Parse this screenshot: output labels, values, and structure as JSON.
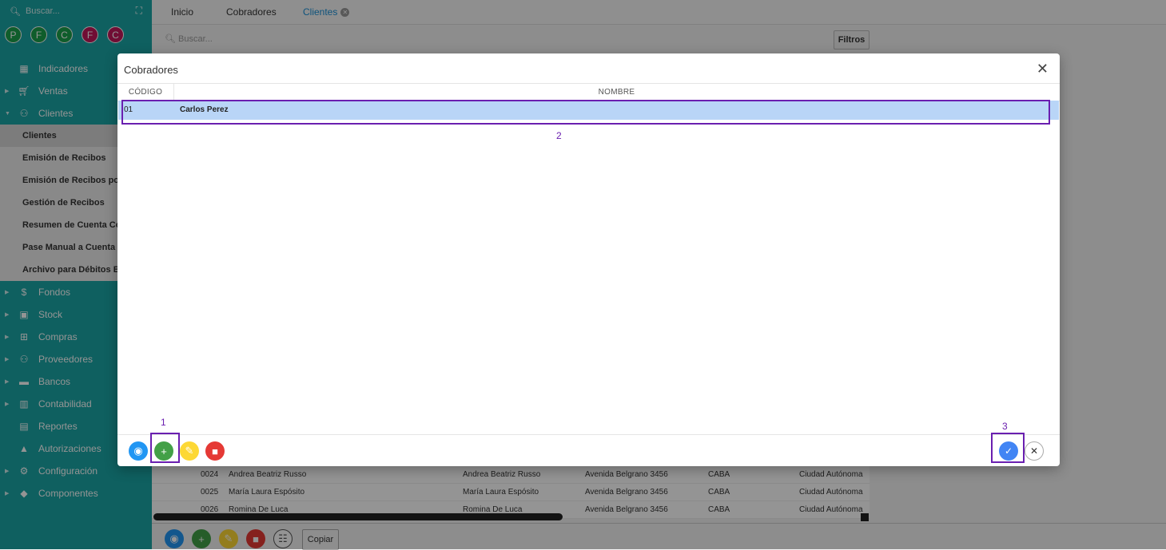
{
  "sidebar": {
    "search_placeholder": "Buscar...",
    "avatars": [
      {
        "letter": "P",
        "color": "#1aa04a"
      },
      {
        "letter": "F",
        "color": "#1aa04a"
      },
      {
        "letter": "C",
        "color": "#1aa04a"
      },
      {
        "letter": "F",
        "color": "#c2185b"
      },
      {
        "letter": "C",
        "color": "#c2185b"
      }
    ],
    "menu_top": [
      {
        "label": "Indicadores",
        "icon": "dashboard-icon"
      },
      {
        "label": "Ventas",
        "icon": "cart-icon"
      },
      {
        "label": "Clientes",
        "icon": "users-icon"
      }
    ],
    "clientes_sub": [
      "Clientes",
      "Emisión de Recibos",
      "Emisión de Recibos por l",
      "Gestión de Recibos",
      "Resumen de Cuenta Corr",
      "Pase Manual a Cuenta C",
      "Archivo para Débitos Bar"
    ],
    "menu_bottom": [
      {
        "label": "Fondos",
        "icon": "dollar-icon"
      },
      {
        "label": "Stock",
        "icon": "box-icon"
      },
      {
        "label": "Compras",
        "icon": "basket-icon"
      },
      {
        "label": "Proveedores",
        "icon": "users-icon"
      },
      {
        "label": "Bancos",
        "icon": "briefcase-icon"
      },
      {
        "label": "Contabilidad",
        "icon": "book-icon"
      },
      {
        "label": "Reportes",
        "icon": "report-icon"
      },
      {
        "label": "Autorizaciones",
        "icon": "lock-icon"
      },
      {
        "label": "Configuración",
        "icon": "cogs-icon"
      },
      {
        "label": "Componentes",
        "icon": "tag-icon"
      }
    ]
  },
  "tabs": [
    "Inicio",
    "Cobradores",
    "Clientes"
  ],
  "main": {
    "search_placeholder": "Buscar...",
    "filtros_label": "Filtros",
    "copiar_label": "Copiar",
    "rows": [
      {
        "code": "0024",
        "name": "Andrea Beatriz Russo",
        "name2": "Andrea Beatriz Russo",
        "address": "Avenida Belgrano 3456",
        "city": "CABA",
        "province": "Ciudad Autónoma"
      },
      {
        "code": "0025",
        "name": "María Laura Espósito",
        "name2": "María Laura Espósito",
        "address": "Avenida Belgrano 3456",
        "city": "CABA",
        "province": "Ciudad Autónoma"
      },
      {
        "code": "0026",
        "name": "Romina De Luca",
        "name2": "Romina De Luca",
        "address": "Avenida Belgrano 3456",
        "city": "CABA",
        "province": "Ciudad Autónoma"
      }
    ]
  },
  "modal": {
    "title": "Cobradores",
    "col_code": "CÓDIGO",
    "col_name": "NOMBRE",
    "rows": [
      {
        "code": "01",
        "name": "Carlos Perez"
      }
    ],
    "annotations": [
      "1",
      "2",
      "3"
    ]
  },
  "colors": {
    "sidebar": "#1aa5a5",
    "view": "#2196f3",
    "add": "#43a047",
    "edit": "#fdd835",
    "delete": "#e53935",
    "confirm": "#4285f4",
    "selected_row": "#b9d5f7",
    "annotation": "#6a1fb0"
  }
}
